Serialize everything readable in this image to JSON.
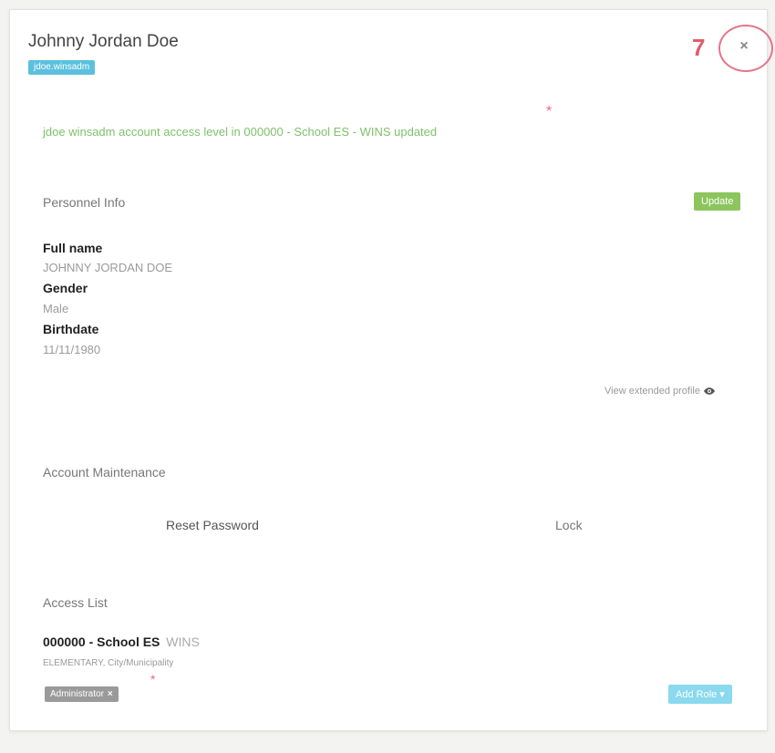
{
  "header": {
    "title": "Johnny Jordan Doe",
    "username": "jdoe.winsadm",
    "annotation_number": "7",
    "close_label": "×"
  },
  "alert": {
    "message": "jdoe winsadm account access level in 000000 - School ES - WINS updated",
    "marker": "*"
  },
  "personnel": {
    "section_title": "Personnel Info",
    "update_label": "Update",
    "fields": [
      {
        "label": "Full name",
        "value": "JOHNNY JORDAN DOE"
      },
      {
        "label": "Gender",
        "value": "Male"
      },
      {
        "label": "Birthdate",
        "value": "11/11/1980"
      }
    ],
    "view_extended_label": "View extended profile"
  },
  "account": {
    "section_title": "Account Maintenance",
    "reset_password_label": "Reset Password",
    "lock_label": "Lock"
  },
  "access": {
    "section_title": "Access List",
    "school_name": "000000 - School ES",
    "school_tag": "WINS",
    "school_sub": "ELEMENTARY, City/Municipality",
    "role_label": "Administrator",
    "role_remove": "×",
    "role_marker": "*",
    "add_role_label": "Add Role ▾"
  }
}
